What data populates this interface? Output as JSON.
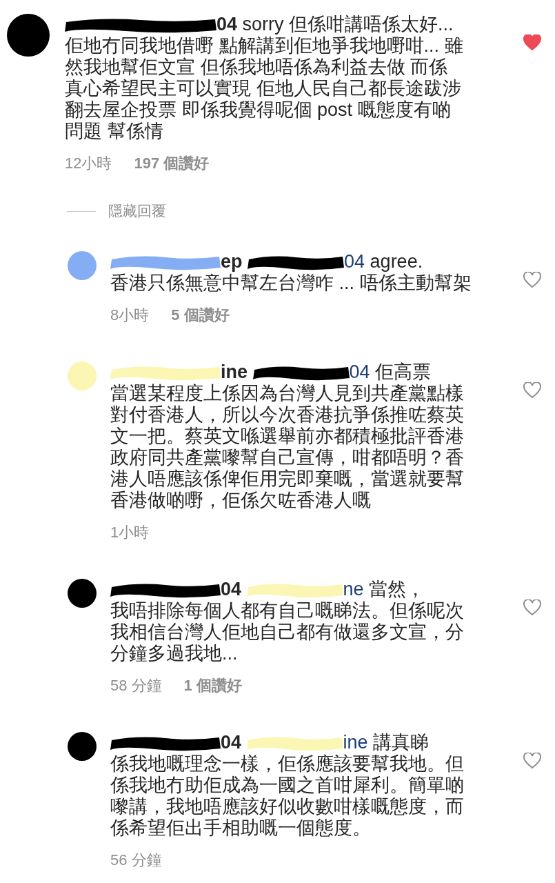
{
  "comment": {
    "avatar": {
      "color": "#000000"
    },
    "user": {
      "visible": "04",
      "color": "#000000"
    },
    "lead": "sorry 但係咁講唔係太好...",
    "text": "佢地冇同我地借嘢 點解講到佢地爭我地嘢咁... 雖然我地幫佢文宣 但係我地唔係為利益去做 而係真心希望民主可以實現 佢地人民自己都長途跋涉翻去屋企投票 即係我覺得呢個 post 嘅態度有啲問題 幫係情",
    "time": "12小時",
    "likes": "197 個讚好",
    "liked": true
  },
  "hide_replies": "隱藏回覆",
  "replies": [
    {
      "avatar": {
        "color": "#85adf4"
      },
      "user": {
        "visible": "ep",
        "color": "#85adf4"
      },
      "mention": {
        "visible": "04",
        "color": "#000000"
      },
      "lead": "agree.",
      "text": "香港只係無意中幫左台灣咋 ... 唔係主動幫架",
      "time": "8小時",
      "likes": "5 個讚好",
      "liked": false
    },
    {
      "avatar": {
        "color": "#fbf6b4"
      },
      "user": {
        "visible": "ine",
        "color": "#fbf6b4"
      },
      "mention": {
        "visible": "04",
        "color": "#000000"
      },
      "lead": "佢高票",
      "text": "當選某程度上係因為台灣人見到共產黨點樣對付香港人，所以今次香港抗爭係推咗蔡英文一把。蔡英文喺選舉前亦都積極批評香港政府同共產黨嚟幫自己宣傳，咁都唔明？香港人唔應該係俾佢用完即棄嘅，當選就要幫香港做啲嘢，佢係欠咗香港人嘅",
      "time": "1小時",
      "liked": false
    },
    {
      "avatar": {
        "color": "#000000"
      },
      "user": {
        "visible": "04",
        "color": "#000000"
      },
      "mention": {
        "visible": "ne",
        "color": "#fbf6b4"
      },
      "lead": "當然，",
      "text": "我唔排除每個人都有自己嘅睇法。但係呢次我相信台灣人佢地自己都有做還多文宣，分分鐘多過我地...",
      "time": "58 分鐘",
      "likes": "1 個讚好",
      "liked": false
    },
    {
      "avatar": {
        "color": "#000000"
      },
      "user": {
        "visible": "04",
        "color": "#000000"
      },
      "mention": {
        "visible": "ine",
        "color": "#fbf6b4"
      },
      "lead": "講真睇",
      "text": "係我地嘅理念一樣，佢係應該要幫我地。但係我地冇助佢成為一國之首咁犀利。簡單啲嚟講，我地唔應該好似收數咁樣嘅態度，而係希望佢出手相助嘅一個態度。",
      "time": "56 分鐘",
      "liked": false
    }
  ]
}
